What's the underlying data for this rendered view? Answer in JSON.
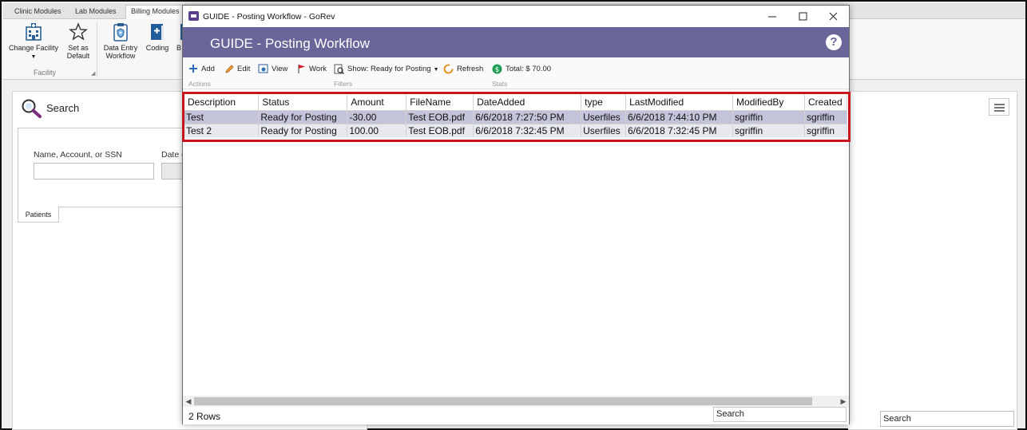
{
  "app": {
    "tabs": [
      "Clinic Modules",
      "Lab Modules",
      "Billing Modules"
    ],
    "ribbon": {
      "change_facility": "Change Facility",
      "set_default_1": "Set as",
      "set_default_2": "Default",
      "facility_group": "Facility",
      "data_entry_1": "Data Entry",
      "data_entry_2": "Workflow",
      "coding": "Coding",
      "cut_label": "B"
    },
    "search_title": "Search",
    "name_label": "Name, Account, or SSN",
    "date_label": "Date o",
    "patients_tab": "Patients",
    "bg_search": "Search"
  },
  "dialog": {
    "window_title": "GUIDE - Posting Workflow - GoRev",
    "header_title": "GUIDE - Posting Workflow",
    "help": "?",
    "toolbar": {
      "add": "Add",
      "edit": "Edit",
      "view": "View",
      "work": "Work",
      "show": "Show: Ready for Posting",
      "refresh": "Refresh",
      "total": "Total: $ 70.00",
      "groups": {
        "actions": "Actions",
        "filters": "Filters",
        "stats": "Stats"
      }
    },
    "grid": {
      "columns": [
        "Description",
        "Status",
        "Amount",
        "FileName",
        "DateAdded",
        "type",
        "LastModified",
        "ModifiedBy",
        "Created"
      ],
      "rows": [
        [
          "Test",
          "Ready for Posting",
          "-30.00",
          "Test EOB.pdf",
          "6/6/2018 7:27:50 PM",
          "Userfiles",
          "6/6/2018 7:44:10 PM",
          "sgriffin",
          "sgriffin"
        ],
        [
          "Test 2",
          "Ready for Posting",
          "100.00",
          "Test EOB.pdf",
          "6/6/2018 7:32:45 PM",
          "Userfiles",
          "6/6/2018 7:32:45 PM",
          "sgriffin",
          "sgriffin"
        ]
      ]
    },
    "row_count": "2 Rows",
    "search": "Search"
  },
  "colors": {
    "header_bg": "#6a6699",
    "selected_row": "#c3c3d9",
    "highlight_border": "#c4161c"
  },
  "icons": [
    "add-icon",
    "edit-icon",
    "view-icon",
    "work-flag-icon",
    "filter-icon",
    "refresh-icon",
    "dollar-icon",
    "help-icon",
    "search-icon",
    "hospital-icon",
    "star-icon",
    "clipboard-icon",
    "book-icon"
  ]
}
